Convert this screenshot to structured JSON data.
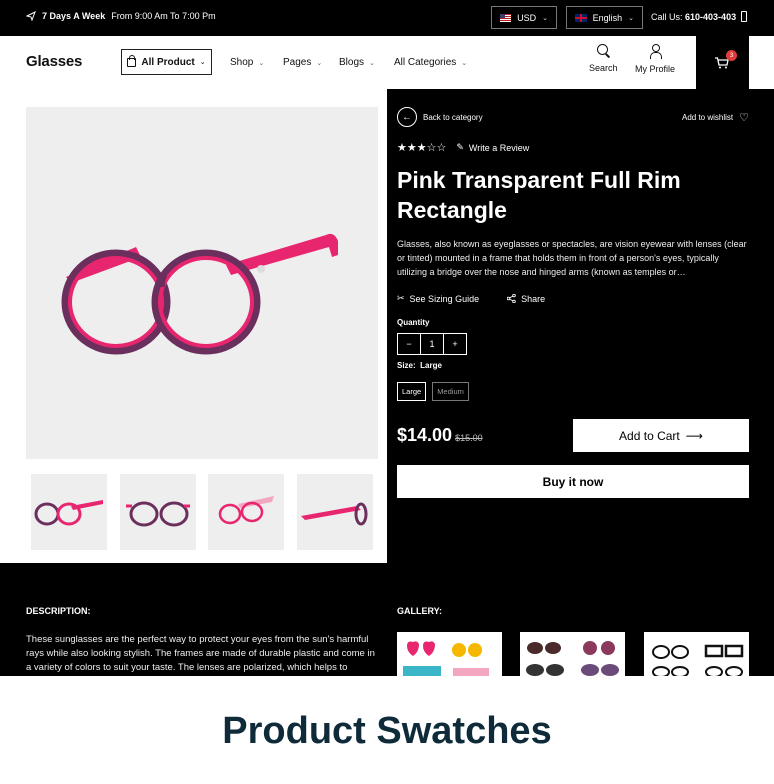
{
  "topbar": {
    "promo_bold": "7 Days A Week",
    "promo_rest": "From 9:00 Am To 7:00 Pm",
    "currency": "USD",
    "language": "English",
    "call_label": "Call Us:",
    "call_number": "610-403-403"
  },
  "header": {
    "logo": "Glasses",
    "all_product": "All Product",
    "nav": [
      "Shop",
      "Pages",
      "Blogs",
      "All Categories"
    ],
    "search_label": "Search",
    "profile_label": "My Profile",
    "cart_count": "3"
  },
  "product": {
    "back_label": "Back to category",
    "wishlist_label": "Add to wishlist",
    "rating": 3,
    "rating_max": 5,
    "review_label": "Write a Review",
    "title": "Pink Transparent Full Rim Rectangle",
    "description": "Glasses, also known as eyeglasses or spectacles, are vision eyewear with lenses (clear or tinted) mounted in a frame that holds them in front of a person's eyes, typically utilizing a bridge over the nose and hinged arms (known as temples or…",
    "sizing_guide": "See Sizing Guide",
    "share": "Share",
    "quantity_label": "Quantity",
    "quantity": "1",
    "minus": "−",
    "plus": "+",
    "size_label": "Size:",
    "size_value": "Large",
    "sizes": [
      "Large",
      "Medium"
    ],
    "price": "$14.00",
    "compare_price": "$15.00",
    "add_to_cart": "Add to Cart",
    "buy_now": "Buy it now"
  },
  "lower": {
    "description_heading": "DESCRIPTION:",
    "description_text": "These sunglasses are the perfect way to protect your eyes from the sun's harmful rays while also looking stylish. The frames are made of durable plastic and come in a variety of colors to suit your taste. The lenses are polarized, which helps to",
    "gallery_heading": "GALLERY:"
  },
  "banner": {
    "title": "Product Swatches"
  },
  "colors": {
    "frame_pink": "#e8266f",
    "frame_purple": "#6b2f5e",
    "cart_badge": "#e03a3a",
    "banner_text": "#0f2b3a"
  }
}
